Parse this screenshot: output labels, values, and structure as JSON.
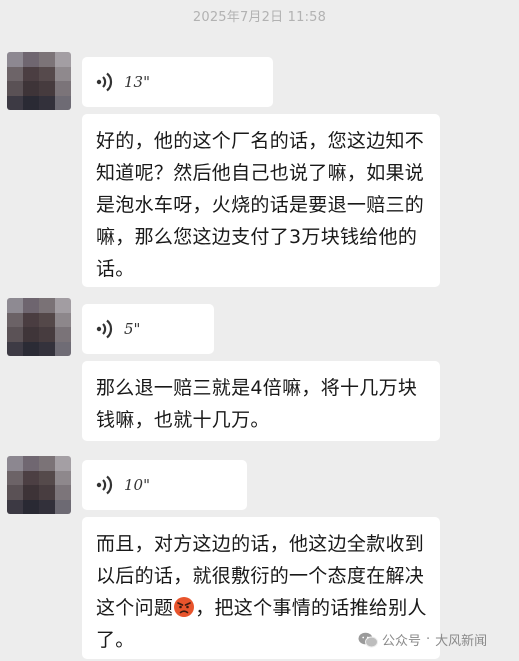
{
  "chat": {
    "timestamp": "2025年7月2日 11:58",
    "messages": [
      {
        "voice_duration": "13\"",
        "text": "好的，他的这个厂名的话，您这边知不知道呢？然后他自己也说了嘛，如果说是泡水车呀，火烧的话是要退一赔三的嘛，那么您这边支付了3万块钱给他的话。"
      },
      {
        "voice_duration": "5\"",
        "text": "那么退一赔三就是4倍嘛，将十几万块钱嘛，也就十几万。"
      },
      {
        "voice_duration": "10\"",
        "text_before_emoji": "而且，对方这边的话，他这边全款收到以后的话，就很敷衍的一个态度在解决这个问题",
        "emoji": "angry-face-emoji",
        "text_after_emoji": "，把这个事情的话推给别人了。"
      }
    ]
  },
  "watermark": {
    "platform": "公众号",
    "separator": "·",
    "source": "大风新闻"
  },
  "colors": {
    "background": "#ededed",
    "bubble": "#ffffff",
    "timestamp": "#b2b2b2",
    "text": "#191919"
  }
}
